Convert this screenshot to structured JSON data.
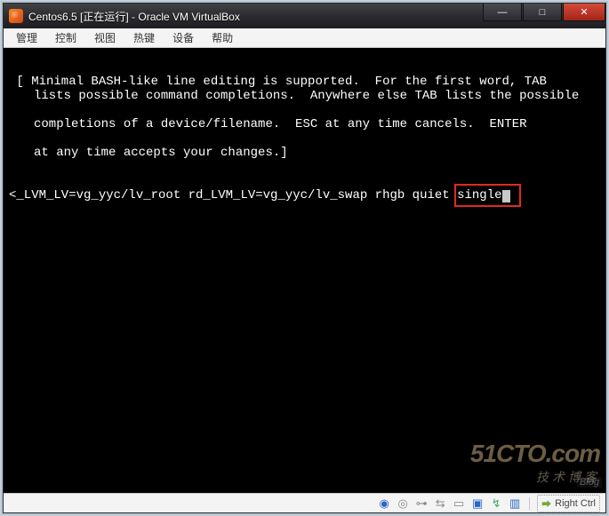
{
  "window": {
    "title": "Centos6.5 [正在运行] - Oracle VM VirtualBox"
  },
  "menu": {
    "items": [
      {
        "label": "管理"
      },
      {
        "label": "控制"
      },
      {
        "label": "视图"
      },
      {
        "label": "热键"
      },
      {
        "label": "设备"
      },
      {
        "label": "帮助"
      }
    ]
  },
  "terminal": {
    "help1": " [ Minimal BASH-like line editing is supported.  For the first word, TAB",
    "help2": "lists possible command completions.  Anywhere else TAB lists the possible",
    "help3": "completions of a device/filename.  ESC at any time cancels.  ENTER",
    "help4": "at any time accepts your changes.]",
    "cmd_prefix": "<_LVM_LV=vg_yyc/lv_root rd_LVM_LV=vg_yyc/lv_swap rhgb quiet ",
    "cmd_hilite": "single"
  },
  "status": {
    "hostkey": "Right Ctrl"
  },
  "watermark": {
    "big": "51CTO.com",
    "small": "技术博客",
    "tag": "Blog"
  },
  "colors": {
    "highlight_box": "#e02a1c"
  }
}
